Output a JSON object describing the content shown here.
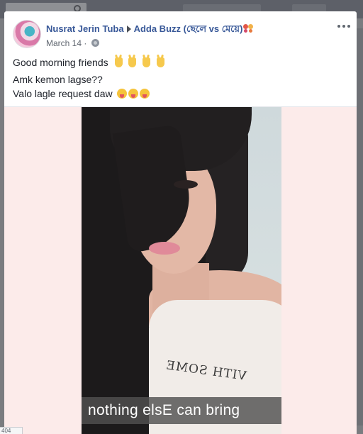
{
  "post": {
    "author": "Nusrat Jerin Tuba",
    "group": "Adda Buzz (ছেলে vs মেয়ে)",
    "date": "March 14",
    "separator": "·",
    "group_icon": "couple-icon",
    "privacy_icon": "globe-icon",
    "menu_icon": "ellipsis-icon",
    "text_lines": [
      "Good morning friends",
      "Amk kemon lagse??",
      "Valo lagle request daw"
    ],
    "line1_emoji": "victory-hand-icon",
    "line3_emoji": "tongue-face-icon",
    "photo_caption": "nothing elsE can bring",
    "photo_shirt_text": "VITH SOME"
  },
  "status_bar": {
    "text": "404"
  },
  "colors": {
    "link": "#385898",
    "text": "#1d2129",
    "meta": "#606770",
    "photo_backdrop": "#fcebea"
  }
}
